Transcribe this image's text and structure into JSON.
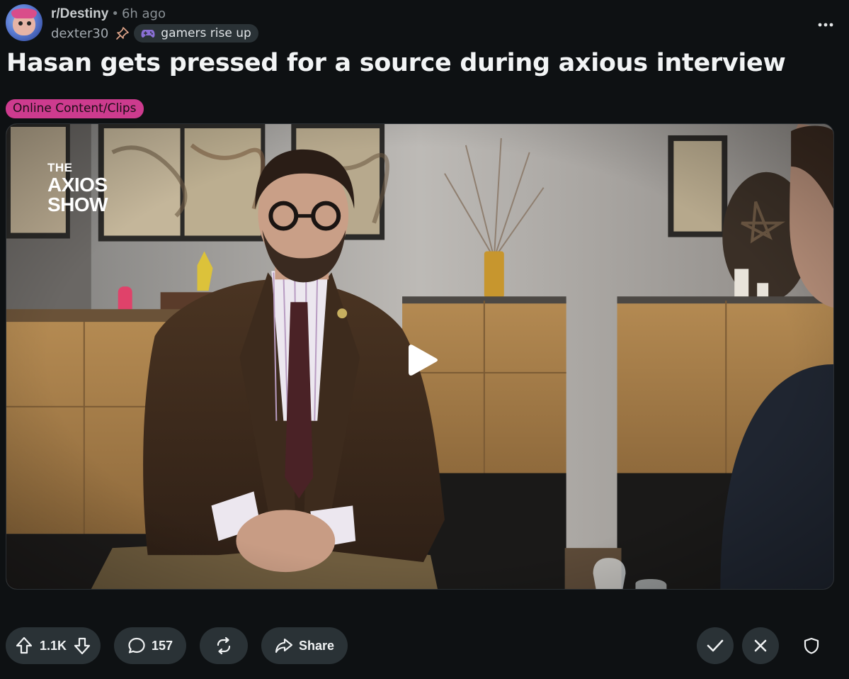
{
  "header": {
    "subreddit": "r/Destiny",
    "separator": "•",
    "time_ago": "6h ago",
    "username": "dexter30",
    "user_flair": "gamers rise up",
    "more_label": "•••"
  },
  "post": {
    "title": "Hasan gets pressed for a source during axious interview",
    "flair": "Online Content/Clips",
    "flair_color": "#cd3b8e"
  },
  "video": {
    "logo_line1": "THE",
    "logo_line2": "AXIOS",
    "logo_line3": "SHOW",
    "state": "paused"
  },
  "actions": {
    "vote_count": "1.1K",
    "comment_count": "157",
    "share_label": "Share"
  },
  "icons": {
    "upvote": "arrow-up-icon",
    "downvote": "arrow-down-icon",
    "comment": "comment-bubble-icon",
    "crosspost": "crosspost-icon",
    "share": "share-arrow-icon",
    "approve": "checkmark-icon",
    "remove": "close-icon",
    "mod": "shield-icon",
    "more": "ellipsis-icon",
    "pin": "pin-icon",
    "flair": "gamepad-icon",
    "play": "play-icon"
  },
  "colors": {
    "background": "#0e1113",
    "pill_background": "#2a3236",
    "text": "#f2f4f5"
  }
}
